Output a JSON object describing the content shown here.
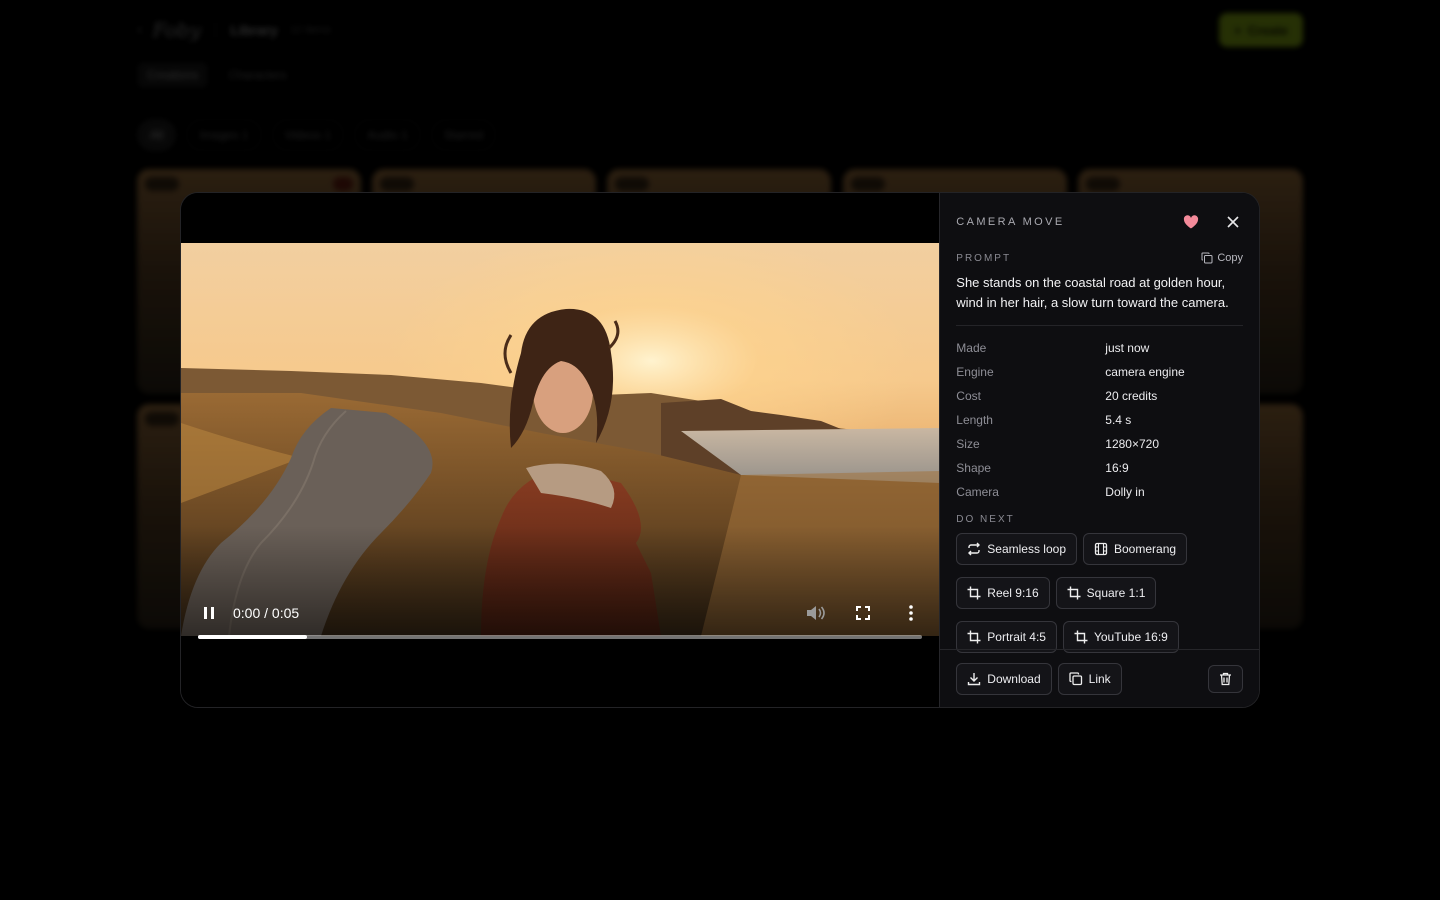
{
  "background": {
    "header": {
      "back_icon": "chevron-left-icon",
      "logo": "Foby",
      "section": "Library",
      "count": "12 items",
      "create_label": "Create"
    },
    "tabs": [
      "Creations",
      "Characters"
    ],
    "filters": [
      "All",
      "Images 1",
      "Videos 1",
      "Audio 1",
      "Starred"
    ]
  },
  "player": {
    "time": "0:00 / 0:05",
    "progress": 0.15,
    "icons": {
      "pause": "pause-icon",
      "volume": "volume-icon",
      "fullscreen": "fullscreen-icon",
      "more": "more-vertical-icon"
    }
  },
  "details": {
    "title": "CAMERA MOVE",
    "favorite_color": "#f48a9a",
    "prompt_label": "PROMPT",
    "copy_label": "Copy",
    "prompt": "She stands on the coastal road at golden hour, wind in her hair, a slow turn toward the camera.",
    "meta": [
      {
        "key": "Made",
        "value": "just now"
      },
      {
        "key": "Engine",
        "value": "camera engine"
      },
      {
        "key": "Cost",
        "value": "20 credits"
      },
      {
        "key": "Length",
        "value": "5.4 s"
      },
      {
        "key": "Size",
        "value": "1280×720"
      },
      {
        "key": "Shape",
        "value": "16:9"
      },
      {
        "key": "Camera",
        "value": "Dolly in"
      }
    ],
    "next_label": "DO NEXT",
    "actions": [
      {
        "label": "Seamless loop",
        "icon": "loop-icon"
      },
      {
        "label": "Boomerang",
        "icon": "film-icon"
      },
      {
        "label": "Reel 9:16",
        "icon": "crop-icon"
      },
      {
        "label": "Square 1:1",
        "icon": "crop-icon"
      },
      {
        "label": "Portrait 4:5",
        "icon": "crop-icon"
      },
      {
        "label": "YouTube 16:9",
        "icon": "crop-icon"
      }
    ],
    "footer": {
      "download_label": "Download",
      "link_label": "Link",
      "delete_icon": "trash-icon"
    }
  }
}
